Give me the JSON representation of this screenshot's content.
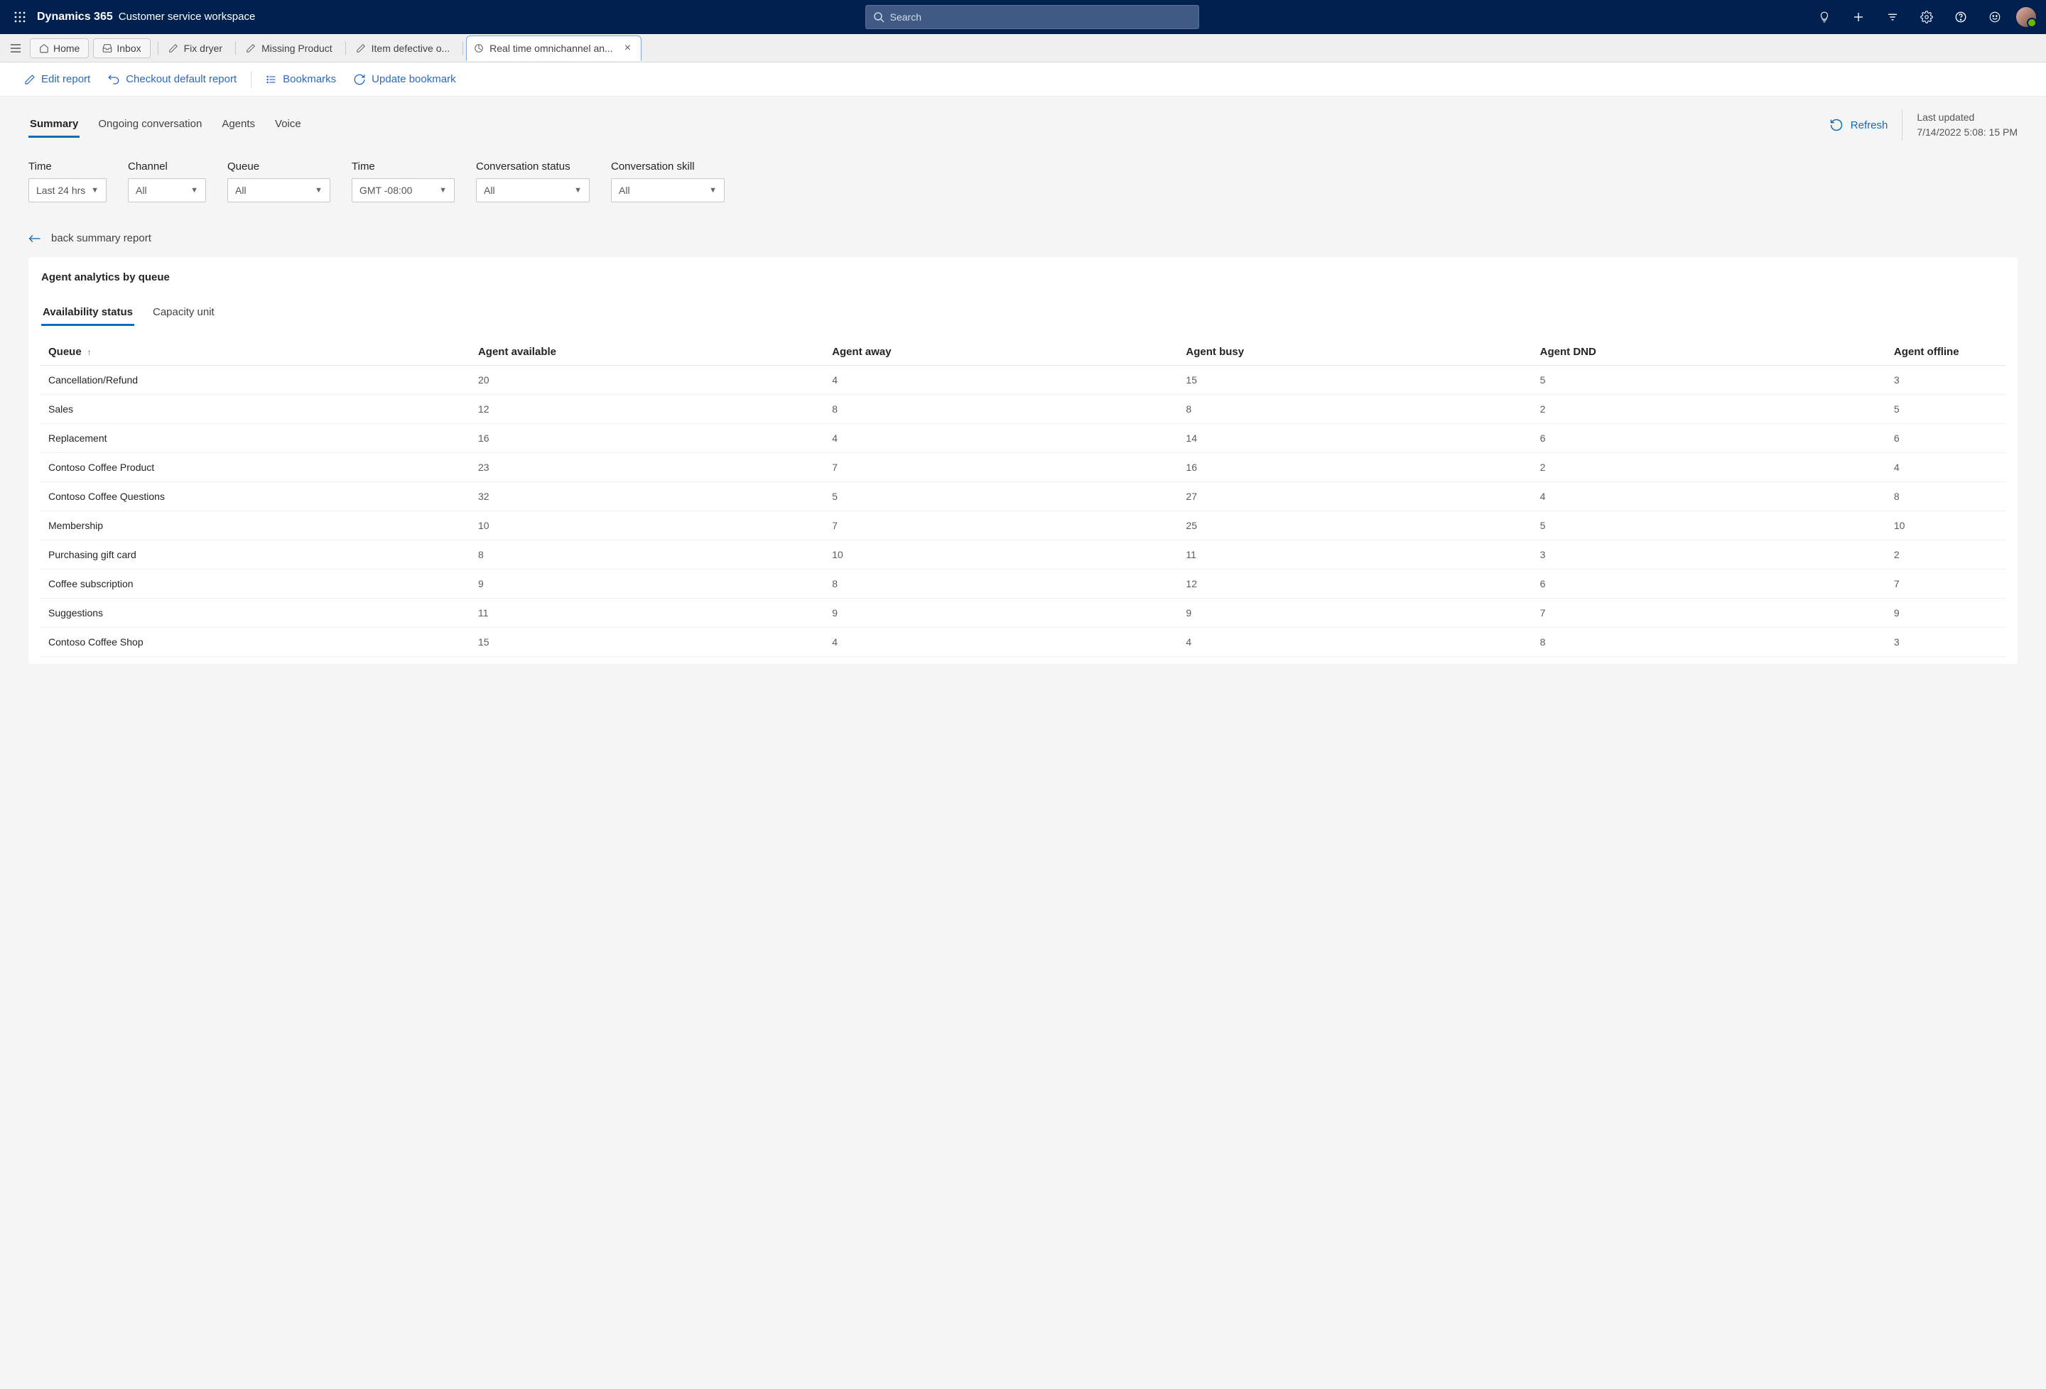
{
  "header": {
    "app_name": "Dynamics 365",
    "workspace": "Customer service workspace",
    "search_placeholder": "Search"
  },
  "nav_tabs": {
    "home": "Home",
    "inbox": "Inbox",
    "tabs": [
      {
        "label": "Fix dryer"
      },
      {
        "label": "Missing Product"
      },
      {
        "label": "Item defective o..."
      },
      {
        "label": "Real time omnichannel an..."
      }
    ]
  },
  "toolbar": {
    "edit": "Edit report",
    "checkout": "Checkout default report",
    "bookmarks": "Bookmarks",
    "update": "Update bookmark"
  },
  "view_tabs": {
    "summary": "Summary",
    "ongoing": "Ongoing conversation",
    "agents": "Agents",
    "voice": "Voice"
  },
  "refresh": {
    "label": "Refresh",
    "last_updated_label": "Last updated",
    "last_updated_value": "7/14/2022 5:08: 15 PM"
  },
  "filters": {
    "time": {
      "label": "Time",
      "value": "Last 24 hrs"
    },
    "channel": {
      "label": "Channel",
      "value": "All"
    },
    "queue": {
      "label": "Queue",
      "value": "All"
    },
    "tz": {
      "label": "Time",
      "value": "GMT -08:00"
    },
    "status": {
      "label": "Conversation status",
      "value": "All"
    },
    "skill": {
      "label": "Conversation skill",
      "value": "All"
    }
  },
  "back_link": "back summary report",
  "panel": {
    "title": "Agent analytics by queue",
    "sub_tab1": "Availability status",
    "sub_tab2": "Capacity unit"
  },
  "table": {
    "headers": {
      "queue": "Queue",
      "avail": "Agent available",
      "away": "Agent away",
      "busy": "Agent busy",
      "dnd": "Agent DND",
      "offline": "Agent offline"
    },
    "rows": [
      {
        "queue": "Cancellation/Refund",
        "avail": "20",
        "away": "4",
        "busy": "15",
        "dnd": "5",
        "offline": "3"
      },
      {
        "queue": "Sales",
        "avail": "12",
        "away": "8",
        "busy": "8",
        "dnd": "2",
        "offline": "5"
      },
      {
        "queue": "Replacement",
        "avail": "16",
        "away": "4",
        "busy": "14",
        "dnd": "6",
        "offline": "6"
      },
      {
        "queue": "Contoso Coffee Product",
        "avail": "23",
        "away": "7",
        "busy": "16",
        "dnd": "2",
        "offline": "4"
      },
      {
        "queue": "Contoso Coffee Questions",
        "avail": "32",
        "away": "5",
        "busy": "27",
        "dnd": "4",
        "offline": "8"
      },
      {
        "queue": "Membership",
        "avail": "10",
        "away": "7",
        "busy": "25",
        "dnd": "5",
        "offline": "10"
      },
      {
        "queue": "Purchasing gift card",
        "avail": "8",
        "away": "10",
        "busy": "11",
        "dnd": "3",
        "offline": "2"
      },
      {
        "queue": "Coffee subscription",
        "avail": "9",
        "away": "8",
        "busy": "12",
        "dnd": "6",
        "offline": "7"
      },
      {
        "queue": "Suggestions",
        "avail": "11",
        "away": "9",
        "busy": "9",
        "dnd": "7",
        "offline": "9"
      },
      {
        "queue": "Contoso Coffee Shop",
        "avail": "15",
        "away": "4",
        "busy": "4",
        "dnd": "8",
        "offline": "3"
      }
    ]
  }
}
